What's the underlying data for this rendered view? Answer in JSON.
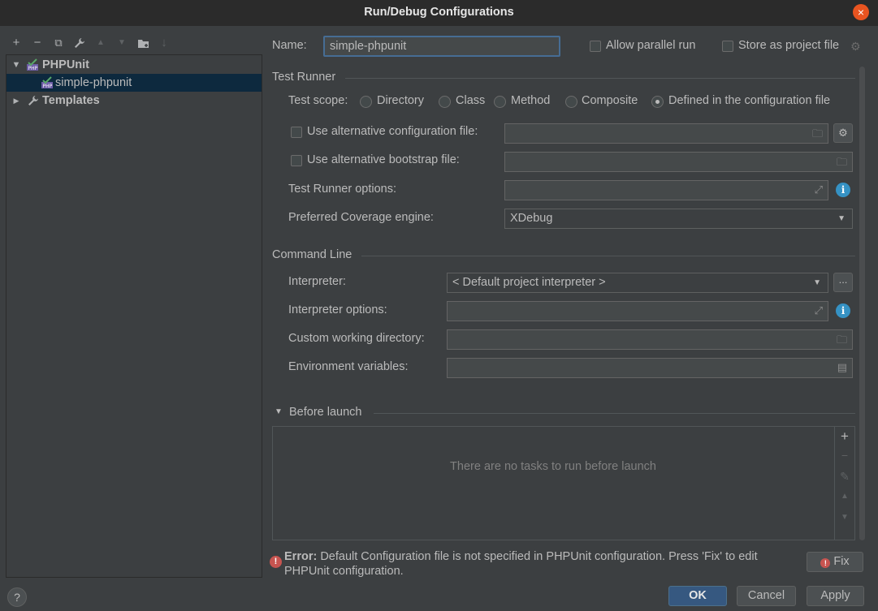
{
  "window": {
    "title": "Run/Debug Configurations",
    "close_icon": "×"
  },
  "left_toolbar": {
    "icons": [
      "add-icon",
      "remove-icon",
      "copy-icon",
      "wrench-icon",
      "move-up-icon",
      "move-down-icon",
      "new-folder-icon",
      "sort-icon"
    ],
    "glyphs": [
      "+",
      "−",
      "⧉",
      "🔧",
      "▲",
      "▼",
      "📁",
      "↓"
    ]
  },
  "tree": {
    "items": [
      {
        "label": "PHPUnit",
        "arrow": "▼"
      },
      {
        "label": "simple-phpunit"
      },
      {
        "label": "Templates",
        "arrow": "▶"
      }
    ]
  },
  "header": {
    "name_label": "Name:",
    "name_value": "simple-phpunit",
    "allow_parallel": "Allow parallel run",
    "store_as_project": "Store as project file"
  },
  "test_runner": {
    "section": "Test Runner",
    "scope_label": "Test scope:",
    "scopes": [
      "Directory",
      "Class",
      "Method",
      "Composite",
      "Defined in the configuration file"
    ],
    "selected_scope": "Defined in the configuration file",
    "alt_config_label": "Use alternative configuration file:",
    "alt_bootstrap_label": "Use alternative bootstrap file:",
    "runner_options_label": "Test Runner options:",
    "coverage_label": "Preferred Coverage engine:",
    "coverage_value": "XDebug"
  },
  "command_line": {
    "section": "Command Line",
    "interpreter_label": "Interpreter:",
    "interpreter_value": "< Default project interpreter >",
    "interpreter_more": "...",
    "interpreter_options_label": "Interpreter options:",
    "working_dir_label": "Custom working directory:",
    "env_vars_label": "Environment variables:"
  },
  "before_launch": {
    "section": "Before launch",
    "empty_text": "There are no tasks to run before launch"
  },
  "error": {
    "prefix": "Error:",
    "message": "Default Configuration file is not specified in PHPUnit configuration. Press 'Fix' to edit PHPUnit configuration.",
    "fix_label": "Fix"
  },
  "footer": {
    "help": "?",
    "ok": "OK",
    "cancel": "Cancel",
    "apply": "Apply"
  },
  "colors": {
    "background": "#3c3f41",
    "selection": "#0d293e",
    "primary_button": "#365880",
    "info": "#3592c4",
    "error": "#c75450",
    "close": "#e95420"
  }
}
